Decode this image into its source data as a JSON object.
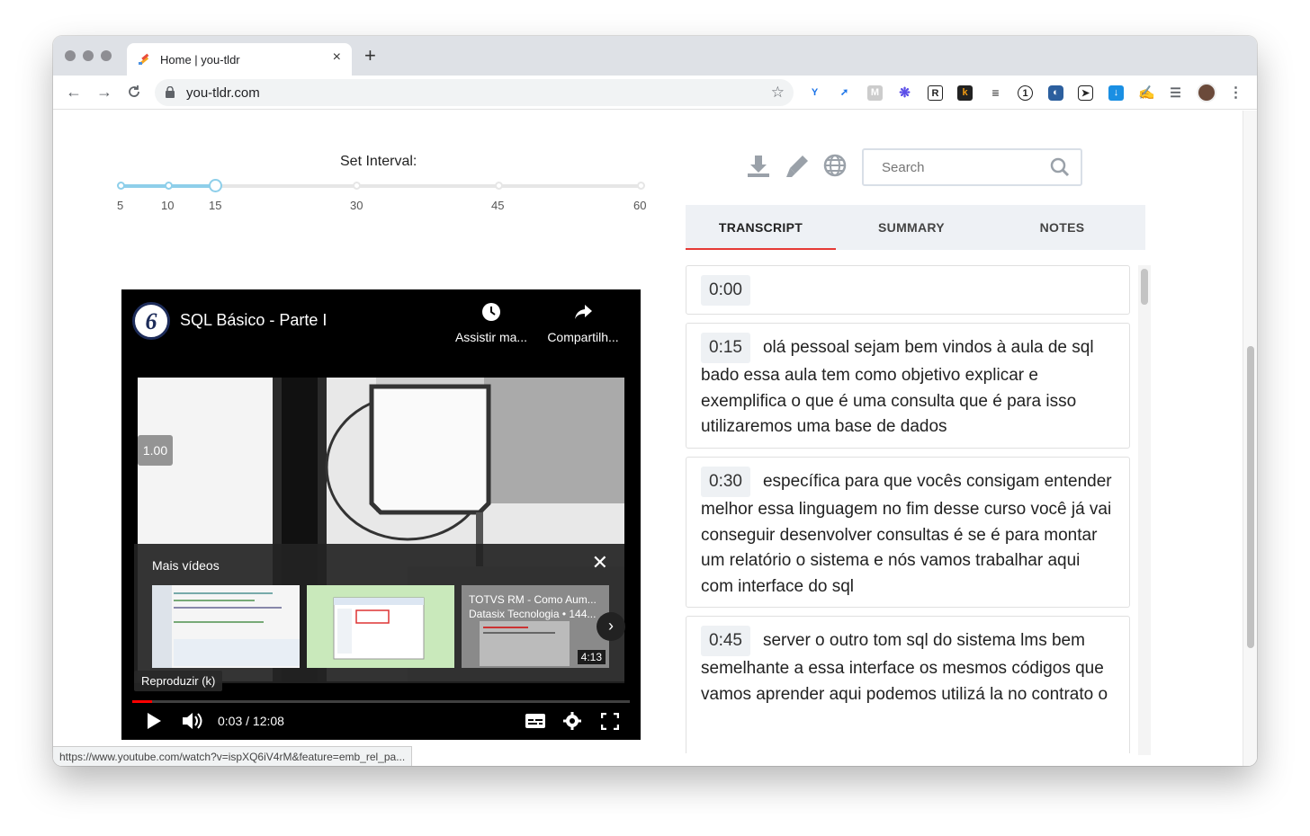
{
  "browser": {
    "tab_title": "Home | you-tldr",
    "new_tab_label": "+",
    "close_label": "×",
    "url": "you-tldr.com",
    "extensions": [
      "yoast-icon",
      "share-icon",
      "mercury-icon",
      "asterisk-icon",
      "readwise-icon",
      "k-icon",
      "list-icon",
      "1password-icon",
      "edge-icon",
      "send-icon",
      "download-icon",
      "puzzle-icon",
      "playlist-icon",
      "profile-avatar",
      "menu-icon"
    ]
  },
  "interval": {
    "label": "Set Interval:",
    "ticks": [
      "5",
      "10",
      "15",
      "30",
      "45",
      "60"
    ],
    "selected": "15"
  },
  "video": {
    "title": "SQL Básico - Parte I",
    "watch_later": "Assistir ma...",
    "share": "Compartilh...",
    "speed": "1.00",
    "more_videos": "Mais vídeos",
    "thumb3_title": "TOTVS RM - Como Aum...",
    "thumb3_channel": "Datasix Tecnologia • 144...",
    "thumb3_duration": "4:13",
    "tooltip": "Reproduzir (k)",
    "time": "0:03 / 12:08",
    "progress_fraction": 0.004
  },
  "panel": {
    "search_placeholder": "Search",
    "tabs": [
      "TRANSCRIPT",
      "SUMMARY",
      "NOTES"
    ],
    "active_tab": "TRANSCRIPT"
  },
  "transcript": [
    {
      "time": "0:00",
      "text": ""
    },
    {
      "time": "0:15",
      "text": "olá pessoal sejam bem vindos à aula de sql bado essa aula tem como objetivo explicar e exemplifica o que é uma consulta que é para isso utilizaremos uma base de dados"
    },
    {
      "time": "0:30",
      "text": "específica para que vocês consigam entender melhor essa linguagem no fim desse curso você já vai conseguir desenvolver consultas é se é para montar um relatório o sistema e nós vamos trabalhar aqui com interface do sql"
    },
    {
      "time": "0:45",
      "text": "server o outro tom sql do sistema lms bem semelhante a essa interface os mesmos códigos que vamos aprender aqui podemos utilizá la no contrato o"
    }
  ],
  "status_url": "https://www.youtube.com/watch?v=ispXQ6iV4rM&feature=emb_rel_pa..."
}
